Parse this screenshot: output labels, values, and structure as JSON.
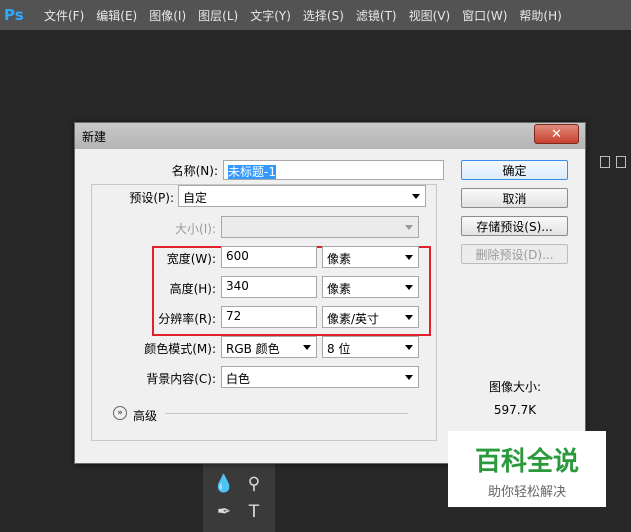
{
  "app": {
    "logo": "Ps"
  },
  "menu": [
    "文件(F)",
    "编辑(E)",
    "图像(I)",
    "图层(L)",
    "文字(Y)",
    "选择(S)",
    "滤镜(T)",
    "视图(V)",
    "窗口(W)",
    "帮助(H)"
  ],
  "dialog": {
    "title": "新建",
    "close_glyph": "✕",
    "name_label": "名称(N):",
    "name_value": "未标题-1",
    "preset_label": "预设(P):",
    "preset_value": "自定",
    "size_label": "大小(I):",
    "size_value": "",
    "width_label": "宽度(W):",
    "width_value": "600",
    "width_unit": "像素",
    "height_label": "高度(H):",
    "height_value": "340",
    "height_unit": "像素",
    "resolution_label": "分辨率(R):",
    "resolution_value": "72",
    "resolution_unit": "像素/英寸",
    "color_mode_label": "颜色模式(M):",
    "color_mode_value": "RGB 颜色",
    "bit_depth_value": "8 位",
    "background_label": "背景内容(C):",
    "background_value": "白色",
    "advanced_label": "高级",
    "buttons": {
      "ok": "确定",
      "cancel": "取消",
      "save_preset": "存储预设(S)...",
      "delete_preset": "删除预设(D)..."
    },
    "image_size_label": "图像大小:",
    "image_size_value": "597.7K"
  },
  "watermark": {
    "title": "百科全说",
    "subtitle": "助你轻松解决"
  },
  "colors": {
    "highlight": "#e0202a",
    "accent": "#31a8ff",
    "watermark": "#2a9a3c"
  }
}
